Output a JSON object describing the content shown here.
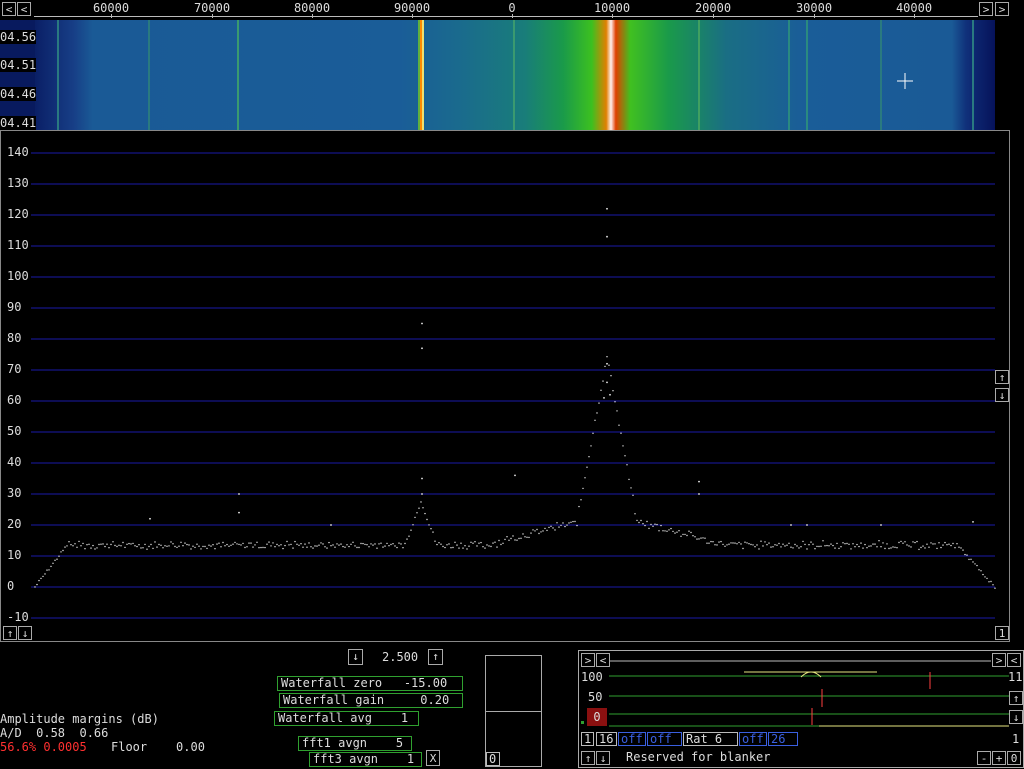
{
  "freq_scale": {
    "labels": [
      "60000",
      "70000",
      "80000",
      "90000",
      "0",
      "10000",
      "20000",
      "30000",
      "40000"
    ],
    "left_arrow": "<",
    "right_arrow": ">"
  },
  "waterfall": {
    "time_labels": [
      "04.56",
      "04.51",
      "04.46",
      "04.41"
    ]
  },
  "spectrum": {
    "y_labels": [
      "140",
      "130",
      "120",
      "110",
      "100",
      "90",
      "80",
      "70",
      "60",
      "50",
      "40",
      "30",
      "20",
      "10",
      "0",
      "-10"
    ],
    "up_arrow": "↑",
    "down_arrow": "↓",
    "marker_btn": "1"
  },
  "controls": {
    "zoom_value": "2.500",
    "waterfall_zero": "Waterfall zero   -15.00",
    "waterfall_gain": "Waterfall gain     0.20",
    "waterfall_avg": "Waterfall avg    1",
    "fft1_avgn": "fft1 avgn    5",
    "fft3_avgn": "fft3 avgn    1",
    "close_btn": "X",
    "amplitude_title": "Amplitude margins (dB)",
    "ad_line": "A/D  0.58  0.66",
    "red_pct": "56.6% 0.0005",
    "floor_line": "Floor    0.00",
    "small_box_label": "0"
  },
  "side_panel": {
    "scale_100": "100",
    "scale_50": "50",
    "scale_0": "0",
    "right_top": "11",
    "right_bottom": "1",
    "btn_1": "1",
    "btn_16": "16",
    "off1": "off",
    "off2": "off",
    "rat": "Rat   6",
    "off3": "off",
    "val26": "26",
    "reserved": "Reserved for blanker",
    "minus": "-",
    "plus": "+",
    "zero": "0"
  },
  "colors": {
    "grid_blue": "#1a1aa8",
    "waterfall_bg": "#123a6e",
    "green_box": "#2fa02f",
    "red_text": "#ff3030"
  }
}
